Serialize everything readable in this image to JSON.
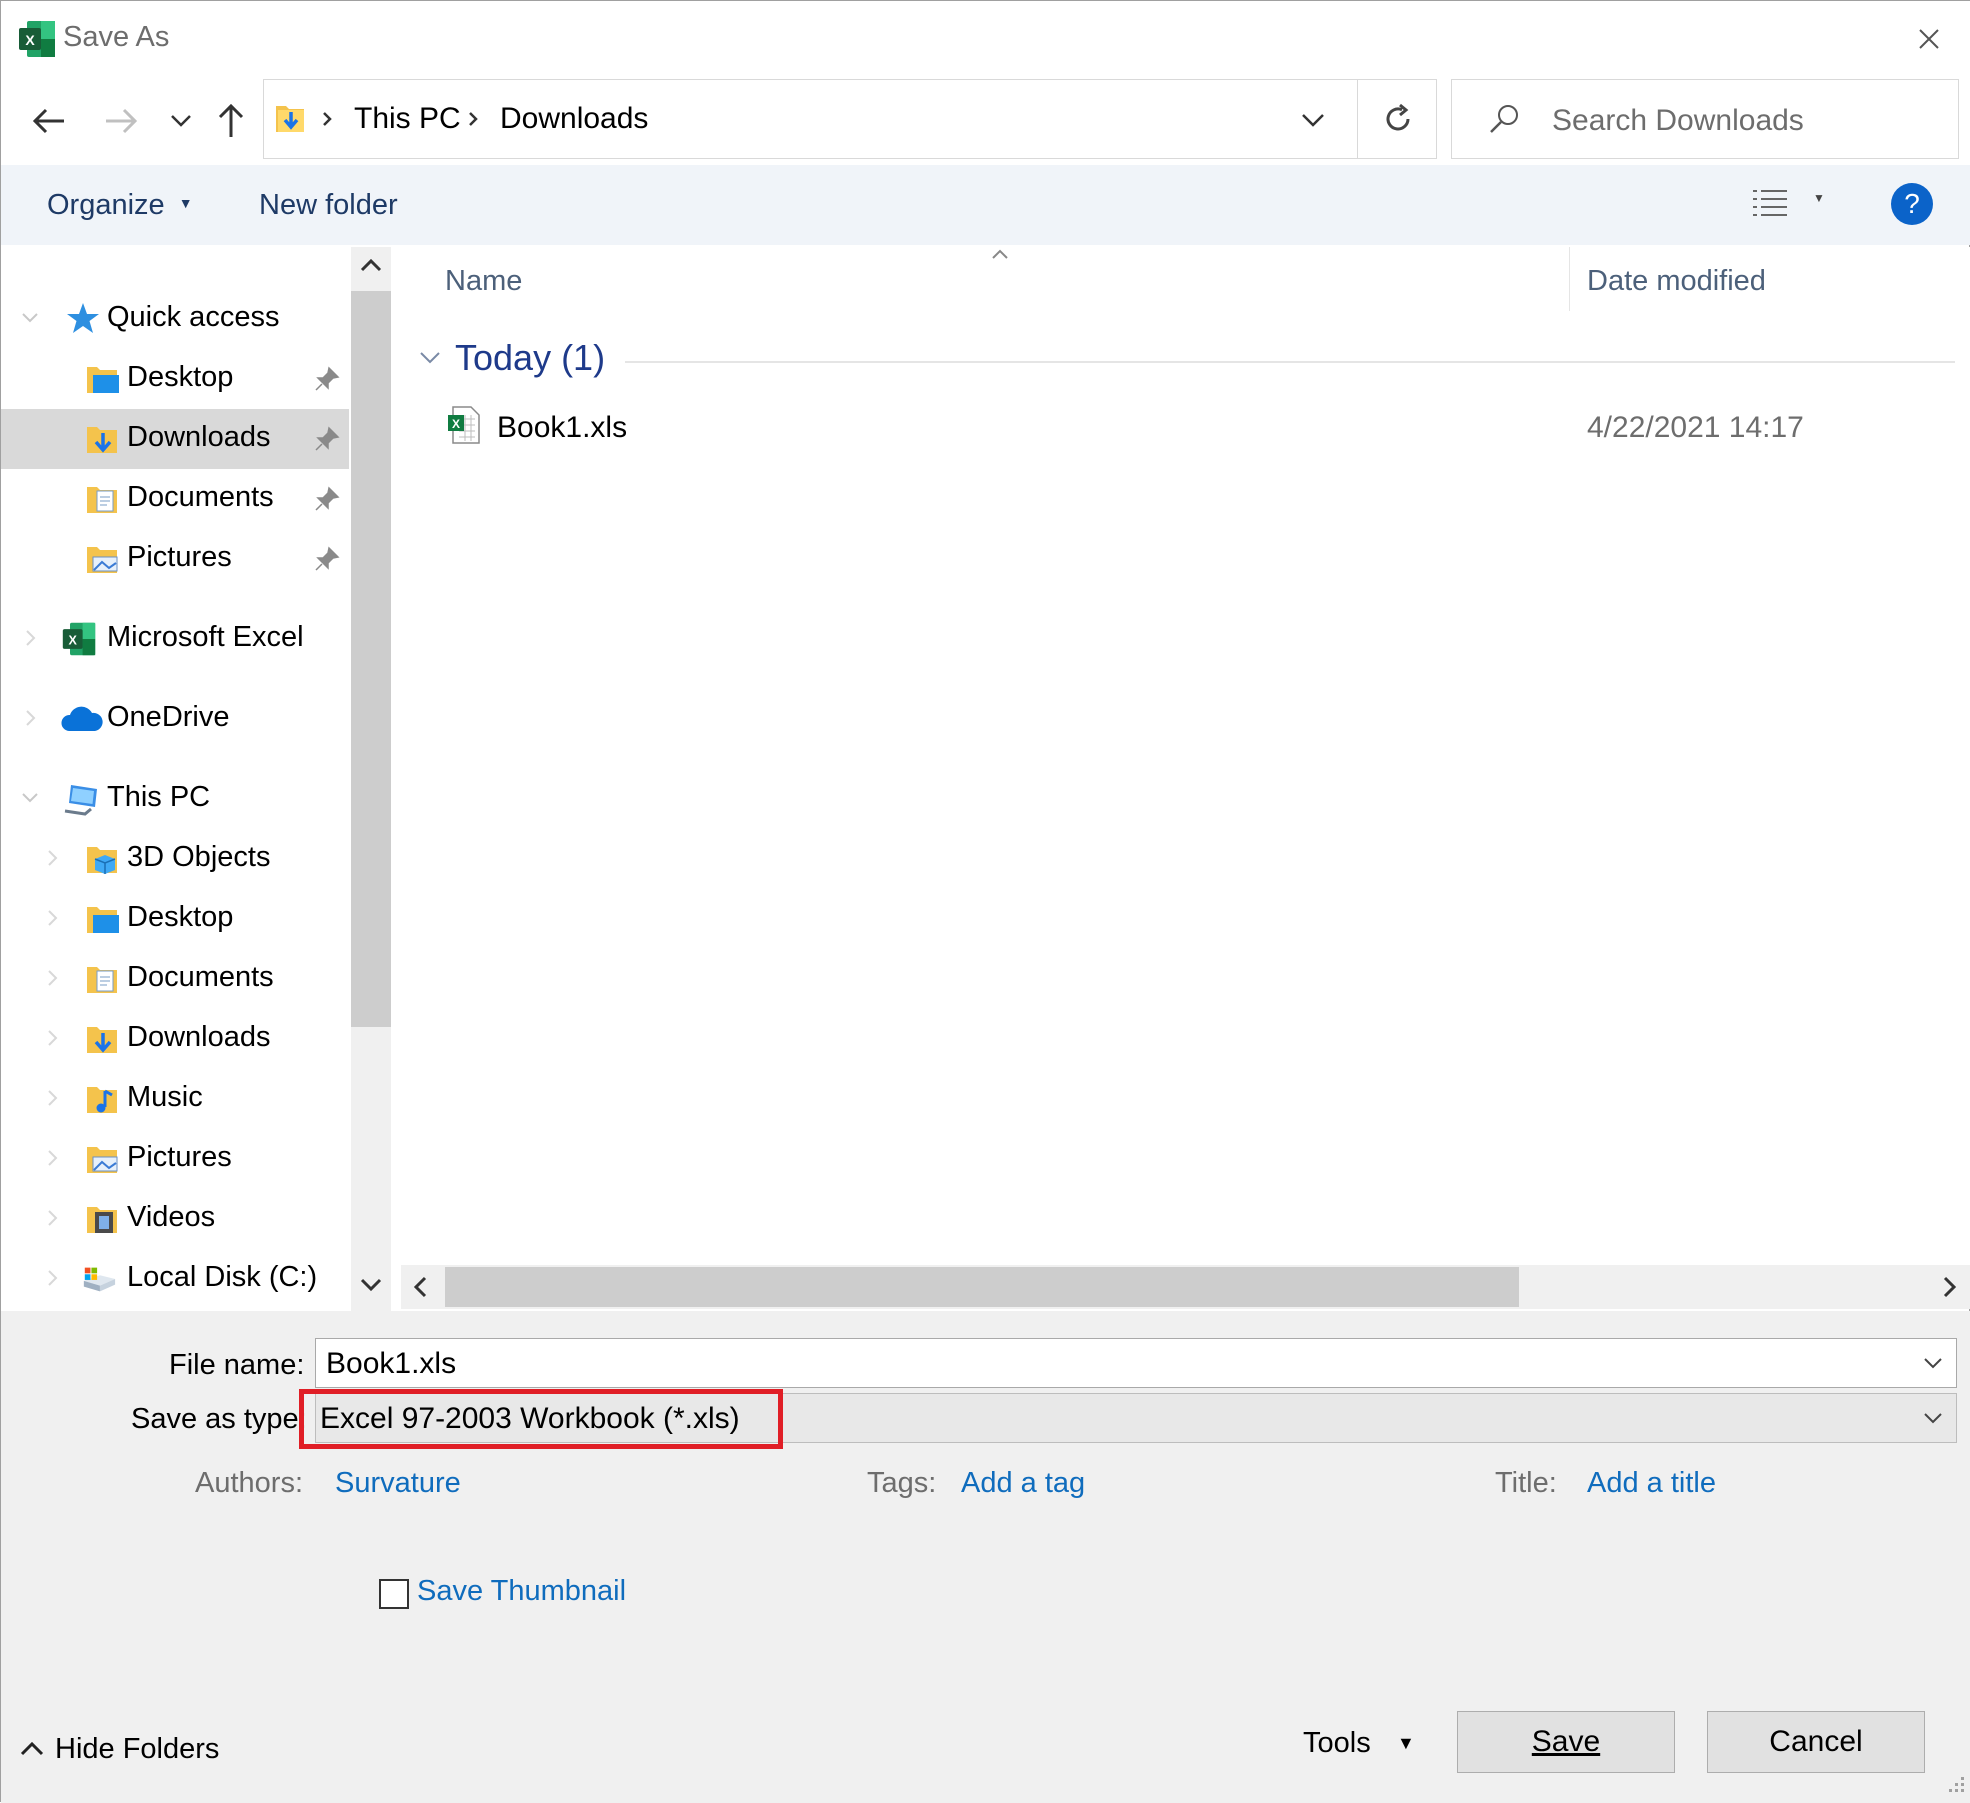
{
  "window": {
    "title": "Save As",
    "app_icon": "excel-icon",
    "close_icon": "close-icon"
  },
  "navigation": {
    "back_icon": "back-arrow-icon",
    "forward_icon": "forward-arrow-icon",
    "recent_icon": "chevron-down-icon",
    "up_icon": "up-arrow-icon",
    "breadcrumb": [
      "This PC",
      "Downloads"
    ],
    "refresh_icon": "refresh-icon",
    "search_placeholder": "Search Downloads"
  },
  "toolbar": {
    "organize_label": "Organize",
    "new_folder_label": "New folder",
    "view_icon": "details-view-icon",
    "help_label": "?"
  },
  "sidebar": {
    "items": [
      {
        "label": "Quick access",
        "icon": "star-icon",
        "level": 0,
        "expanded": true
      },
      {
        "label": "Desktop",
        "icon": "desktop-folder-icon",
        "level": 1,
        "pinned": true
      },
      {
        "label": "Downloads",
        "icon": "downloads-folder-icon",
        "level": 1,
        "pinned": true,
        "selected": true
      },
      {
        "label": "Documents",
        "icon": "documents-folder-icon",
        "level": 1,
        "pinned": true
      },
      {
        "label": "Pictures",
        "icon": "pictures-folder-icon",
        "level": 1,
        "pinned": true
      },
      {
        "label": "Microsoft Excel",
        "icon": "excel-icon",
        "level": 0
      },
      {
        "label": "OneDrive",
        "icon": "cloud-icon",
        "level": 0
      },
      {
        "label": "This PC",
        "icon": "computer-icon",
        "level": 0,
        "expanded": true
      },
      {
        "label": "3D Objects",
        "icon": "3d-objects-folder-icon",
        "level": 1
      },
      {
        "label": "Desktop",
        "icon": "desktop-folder-icon",
        "level": 1
      },
      {
        "label": "Documents",
        "icon": "documents-folder-icon",
        "level": 1
      },
      {
        "label": "Downloads",
        "icon": "downloads-folder-icon",
        "level": 1
      },
      {
        "label": "Music",
        "icon": "music-folder-icon",
        "level": 1
      },
      {
        "label": "Pictures",
        "icon": "pictures-folder-icon",
        "level": 1
      },
      {
        "label": "Videos",
        "icon": "videos-folder-icon",
        "level": 1
      },
      {
        "label": "Local Disk (C:)",
        "icon": "disk-icon",
        "level": 1
      }
    ]
  },
  "file_list": {
    "columns": [
      "Name",
      "Date modified"
    ],
    "groups": [
      {
        "label": "Today (1)",
        "files": [
          {
            "name": "Book1.xls",
            "date": "4/22/2021 14:17",
            "icon": "excel-file-icon"
          }
        ]
      }
    ]
  },
  "form": {
    "file_name_label": "File name:",
    "file_name_value": "Book1.xls",
    "save_type_label": "Save as type:",
    "save_type_value": "Excel 97-2003 Workbook (*.xls)",
    "authors_label": "Authors:",
    "authors_value": "Survature",
    "tags_label": "Tags:",
    "tags_value": "Add a tag",
    "title_label": "Title:",
    "title_value": "Add a title",
    "thumbnail_label": "Save Thumbnail",
    "thumbnail_checked": false
  },
  "footer": {
    "hide_folders_label": "Hide Folders",
    "tools_label": "Tools",
    "save_label": "Save",
    "cancel_label": "Cancel"
  },
  "colors": {
    "accent": "#0f6cbd",
    "highlight_box": "#e01e26",
    "toolbar_bg": "#f0f4f9",
    "selected_row": "#d9d9d9"
  }
}
